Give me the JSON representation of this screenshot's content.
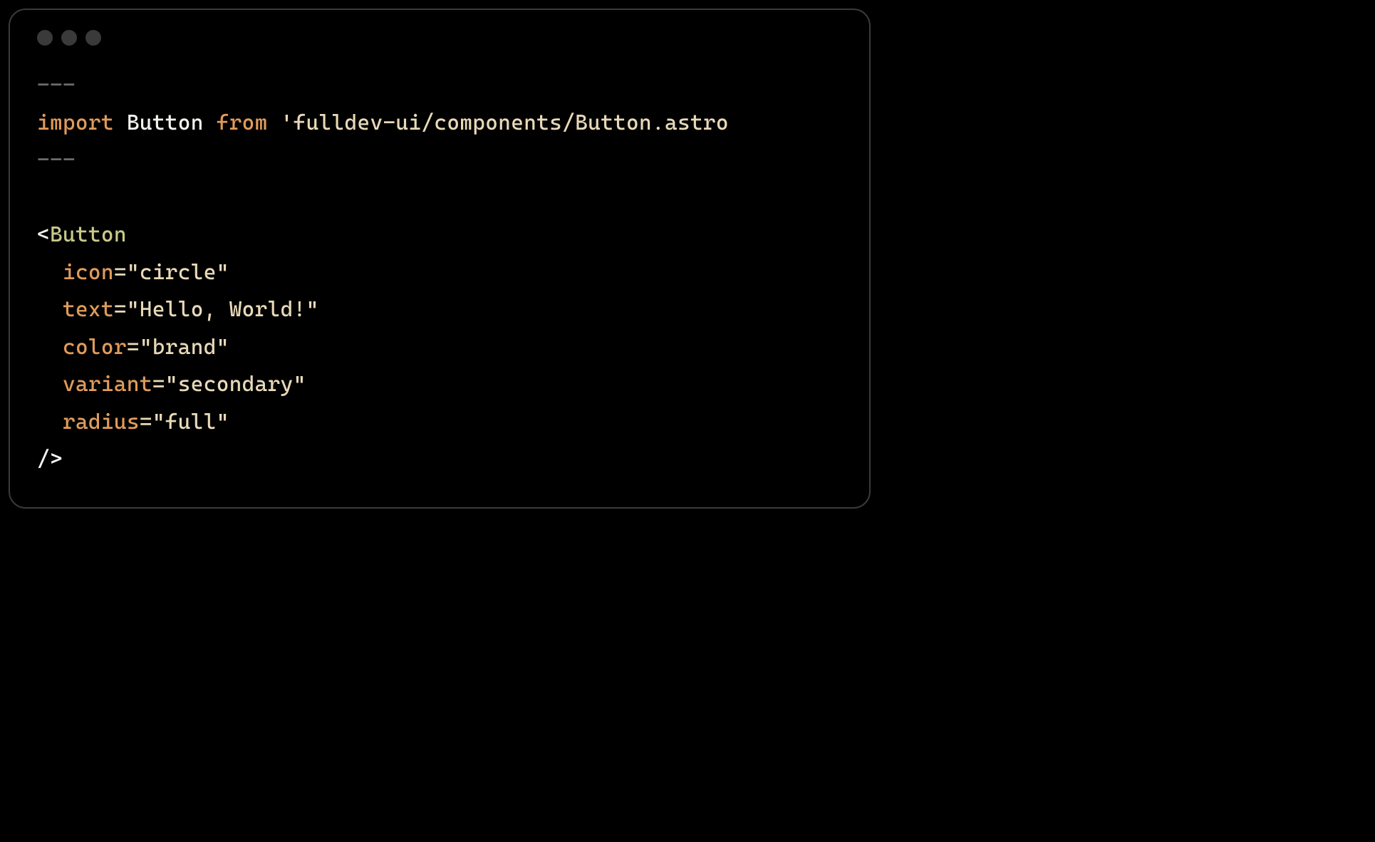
{
  "code": {
    "frontmatter_open": "---",
    "import_keyword": "import",
    "import_name": "Button",
    "from_keyword": "from",
    "import_path": "'fulldev-ui/components/Button.astro",
    "frontmatter_close": "---",
    "tag_open_bracket": "<",
    "component_name": "Button",
    "attrs": [
      {
        "name": "icon",
        "equals": "=",
        "value": "\"circle\""
      },
      {
        "name": "text",
        "equals": "=",
        "value": "\"Hello, World!\""
      },
      {
        "name": "color",
        "equals": "=",
        "value": "\"brand\""
      },
      {
        "name": "variant",
        "equals": "=",
        "value": "\"secondary\""
      },
      {
        "name": "radius",
        "equals": "=",
        "value": "\"full\""
      }
    ],
    "tag_close": "/>"
  }
}
